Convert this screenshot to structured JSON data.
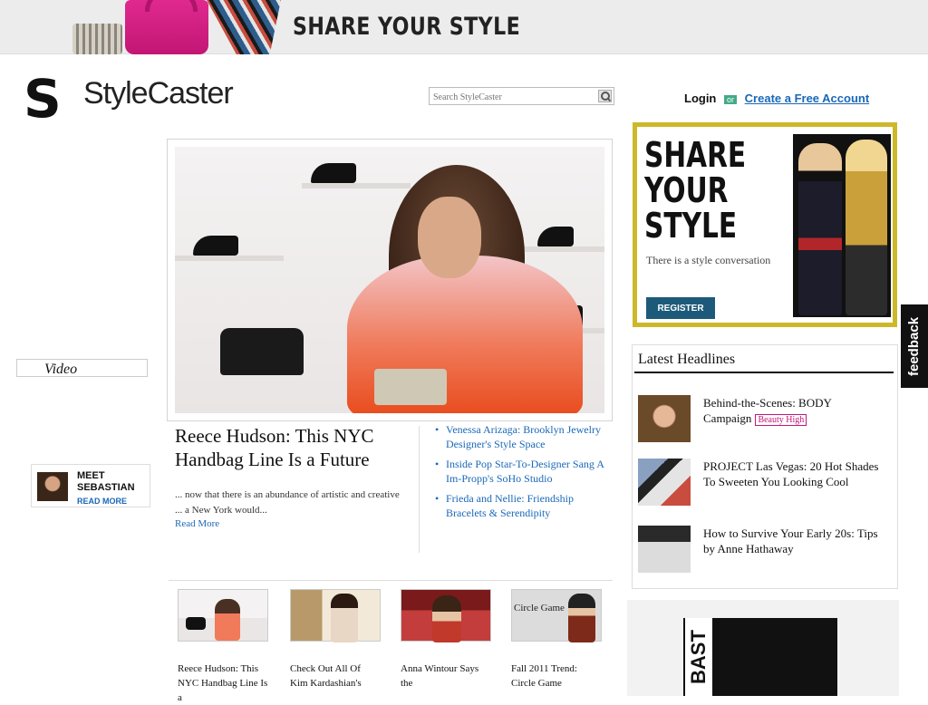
{
  "banner": {
    "title": "SHARE YOUR STYLE"
  },
  "header": {
    "logo_mark": "S",
    "logo_text": "StyleCaster",
    "search_placeholder": "Search StyleCaster",
    "login": "Login",
    "or": "or",
    "create_account": "Create a Free Account"
  },
  "nav": {
    "video": "Video"
  },
  "hero": {
    "title": "Reece Hudson: This NYC Handbag Line Is a Future",
    "text": "... now that there is an abundance of artistic and creative ... a New York would...",
    "read_more": "Read More"
  },
  "related": [
    "Venessa Arizaga: Brooklyn Jewelry Designer's Style Space",
    "Inside Pop Star-To-Designer Sang A Im-Propp's SoHo Studio",
    "Frieda and Nellie: Friendship Bracelets & Serendipity"
  ],
  "meet": {
    "heading": "",
    "name": "MEET SEBASTIAN",
    "read_more": "READ MORE"
  },
  "thumbs": [
    {
      "caption": "Reece Hudson: This NYC Handbag Line Is a"
    },
    {
      "caption": "Check Out All Of Kim Kardashian's"
    },
    {
      "caption": "Anna Wintour Says the"
    },
    {
      "caption": "Fall 2011 Trend: Circle Game",
      "overlay": "Circle Game"
    }
  ],
  "ad": {
    "title": "SHARE\nYOUR\nSTYLE",
    "text": "There is a style conversation",
    "register": "REGISTER"
  },
  "feedback": "feedback",
  "latest": {
    "title": "Latest Headlines",
    "items": [
      {
        "text": "Behind-the-Scenes: BODY Campaign",
        "tag": "Beauty High"
      },
      {
        "text": "PROJECT Las Vegas: 20 Hot Shades To Sweeten You Looking Cool"
      },
      {
        "text": "How to Survive Your Early 20s: Tips by Anne Hathaway"
      }
    ]
  },
  "bottom_ad": {
    "text": "BAST"
  }
}
